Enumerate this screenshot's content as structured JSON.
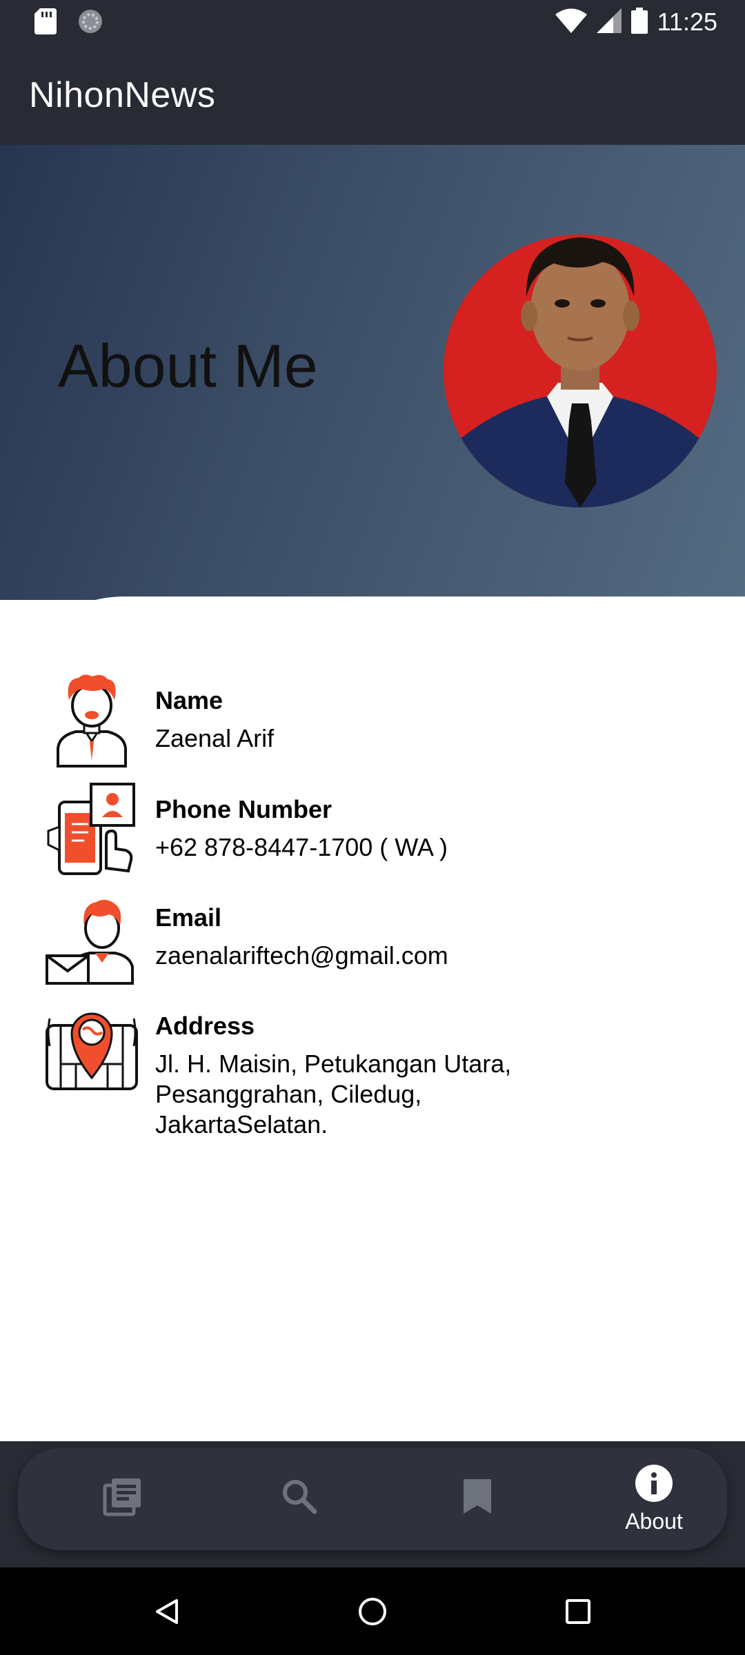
{
  "status_bar": {
    "time": "11:25"
  },
  "app_bar": {
    "title": "NihonNews"
  },
  "header": {
    "heading": "About Me"
  },
  "info": [
    {
      "label": "Name",
      "value": "Zaenal Arif",
      "icon": "person-icon"
    },
    {
      "label": "Phone Number",
      "value": "+62 878-8447-1700 ( WA )",
      "icon": "phone-contact-icon"
    },
    {
      "label": "Email",
      "value": "zaenalariftech@gmail.com",
      "icon": "email-person-icon"
    },
    {
      "label": "Address",
      "value_lines": [
        "Jl. H. Maisin, Petukangan Utara,",
        "Pesanggrahan, Ciledug,",
        "JakartaSelatan."
      ],
      "icon": "location-map-icon"
    }
  ],
  "bottom_nav": {
    "items": [
      {
        "icon": "news-icon",
        "label": ""
      },
      {
        "icon": "search-icon",
        "label": ""
      },
      {
        "icon": "bookmark-icon",
        "label": ""
      },
      {
        "icon": "info-icon",
        "label": "About",
        "active": true
      }
    ]
  },
  "colors": {
    "accent": "#f04e2c",
    "bar_bg": "#282b34",
    "nav_inactive": "#6e727c"
  }
}
